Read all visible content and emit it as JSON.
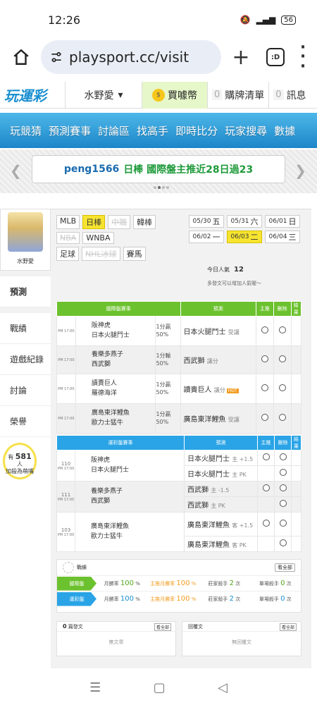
{
  "status": {
    "time": "12:26",
    "battery": "56"
  },
  "browser": {
    "url": "playsport.cc/visit"
  },
  "site": {
    "logo": "玩運彩",
    "user": "水野愛",
    "coin_label": "買噱幣",
    "cart_count": "0",
    "cart_label": "購牌清單",
    "msg_count": "0",
    "msg_label": "訊息"
  },
  "nav": [
    "玩競猜",
    "預測賽事",
    "討論區",
    "找高手",
    "即時比分",
    "玩家搜尋",
    "數據"
  ],
  "ticker": {
    "name": "peng1566",
    "text": "日棒 國際盤主推近28日過23"
  },
  "sidebar": {
    "user": "水野愛",
    "items": [
      "預測",
      "戰績",
      "遊戲紀錄",
      "討論",
      "榮譽"
    ],
    "watch_prefix": "有",
    "watch_count": "581",
    "watch_suffix": "人",
    "watch_line2": "加殺為萌嘴"
  },
  "filters": {
    "row1": [
      "MLB",
      "日棒",
      "中職",
      "韓棒"
    ],
    "row2": [
      "NBA",
      "WNBA"
    ],
    "row3": [
      "足球",
      "NHL冰球",
      "賽馬"
    ]
  },
  "dates": [
    {
      "d": "05/30",
      "w": "五"
    },
    {
      "d": "05/31",
      "w": "六"
    },
    {
      "d": "06/01",
      "w": "日"
    },
    {
      "d": "06/02",
      "w": "一"
    },
    {
      "d": "06/03",
      "w": "二"
    },
    {
      "d": "06/04",
      "w": "三"
    }
  ],
  "popularity": {
    "label": "今日人氣",
    "value": "12",
    "note": "多發文可以增加人氣喔～"
  },
  "intl": {
    "headers": [
      "國際盤賽事",
      "預測",
      "主推",
      "刪除",
      "結果"
    ],
    "rows": [
      {
        "time": "PM 17:00",
        "t1": "阪神虎",
        "t2": "日本火腿鬥士",
        "odds1": "1分贏",
        "odds2": "50%",
        "pick": "日本火腿鬥士",
        "tag": "受讓",
        "hot": ""
      },
      {
        "time": "PM 17:00",
        "t1": "養樂多燕子",
        "t2": "西武獅",
        "odds1": "1分輸",
        "odds2": "50%",
        "pick": "西武獅",
        "tag": "讓分",
        "hot": ""
      },
      {
        "time": "PM 17:00",
        "t1": "讀賣巨人",
        "t2": "羅德海洋",
        "odds1": "1分贏",
        "odds2": "50%",
        "pick": "讀賣巨人",
        "tag": "讓分",
        "hot": "HOT"
      },
      {
        "time": "PM 17:00",
        "t1": "廣島東洋鯉魚",
        "t2": "歐力士猛牛",
        "odds1": "1分贏",
        "odds2": "50%",
        "pick": "廣島東洋鯉魚",
        "tag": "受讓",
        "hot": ""
      }
    ]
  },
  "local": {
    "headers": [
      "運彩盤賽事",
      "預測",
      "主推",
      "刪除",
      "結果"
    ],
    "rows": [
      {
        "num": "110",
        "time": "PM 17:00",
        "t1": "阪神虎",
        "t2": "日本火腿鬥士",
        "p1": "日本火腿鬥士",
        "p1tag": "主 +1.5",
        "p2": "日本火腿鬥士",
        "p2tag": "主 PK"
      },
      {
        "num": "111",
        "time": "PM 17:00",
        "t1": "養樂多燕子",
        "t2": "西武獅",
        "p1": "西武獅",
        "p1tag": "主 -1.5",
        "p2": "西武獅",
        "p2tag": "主 PK"
      },
      {
        "num": "103",
        "time": "PM 17:00",
        "t1": "廣島東洋鯉魚",
        "t2": "歐力士猛牛",
        "p1": "廣島東洋鯉魚",
        "p1tag": "客 +1.5",
        "p2": "廣島東洋鯉魚",
        "p2tag": "客 PK"
      }
    ]
  },
  "stats": {
    "title": "戰績",
    "see_all": "看全部",
    "rows": [
      {
        "tab": "國際盤",
        "win_label": "月勝率",
        "win": "100",
        "main_label": "主推月勝率",
        "main": "100",
        "streak_label": "莊家殺手",
        "streak": "2",
        "kill_label": "單場殺手",
        "kill": "0",
        "unit": "次",
        "pct": "%"
      },
      {
        "tab": "運彩盤",
        "win_label": "月勝率",
        "win": "100",
        "main_label": "主推月勝率",
        "main": "100",
        "streak_label": "莊家殺手",
        "streak": "2",
        "kill_label": "單場殺手",
        "kill": "0",
        "unit": "次",
        "pct": "%"
      }
    ],
    "colors": {
      "intl": "#6cc12e",
      "local": "#2aa4e6"
    }
  },
  "posts": {
    "left_count": "0",
    "left_label": "篇發文",
    "left_see": "看全部",
    "left_empty": "無文章",
    "right_label": "回覆文",
    "right_see": "看全部",
    "right_empty": "無回覆文"
  }
}
